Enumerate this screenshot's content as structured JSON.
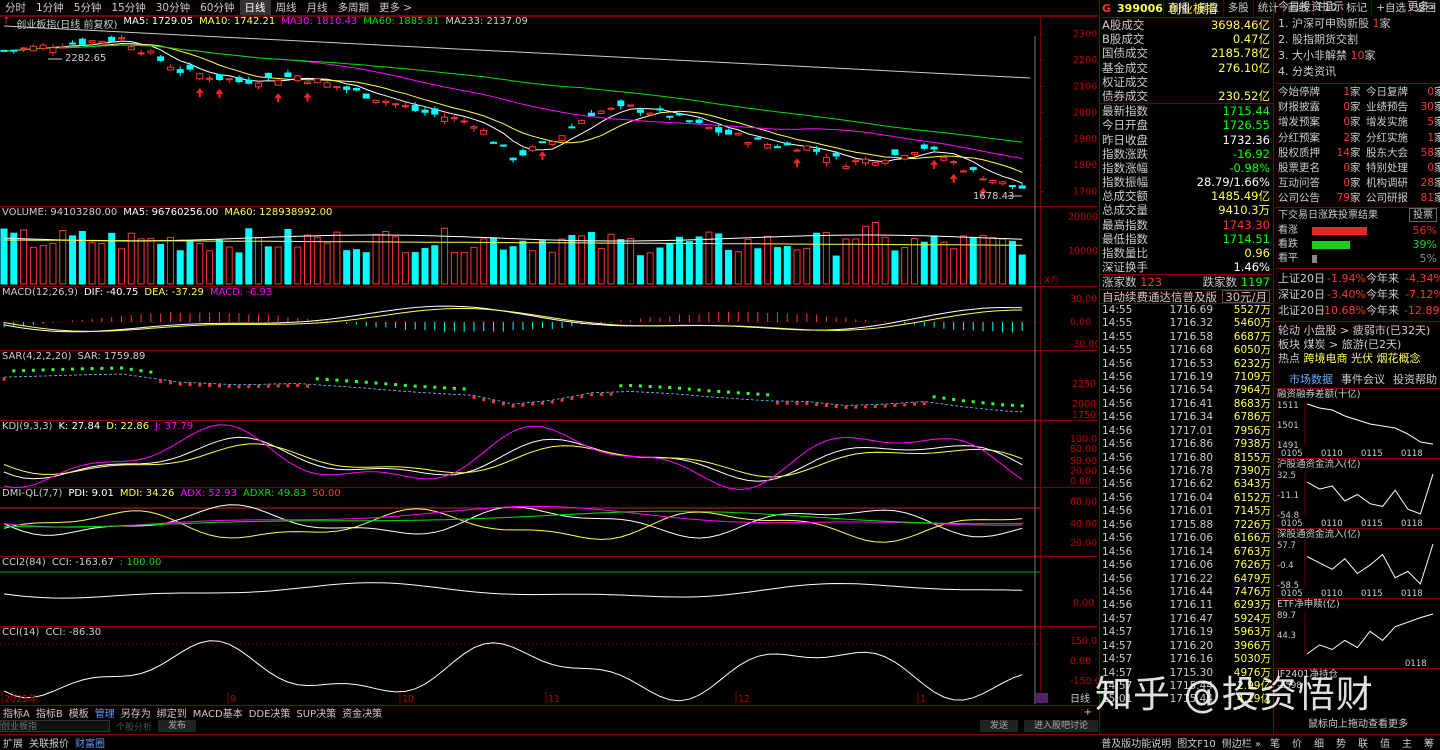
{
  "toolbar": {
    "periods": [
      "分时",
      "1分钟",
      "5分钟",
      "15分钟",
      "30分钟",
      "60分钟",
      "日线",
      "周线",
      "月线",
      "多周期",
      "更多 >"
    ],
    "active": "日线",
    "tools": [
      "直播",
      "复盘",
      "多股",
      "统计",
      "画线",
      "F10",
      "标记",
      "+自选",
      "返回"
    ]
  },
  "indicators": {
    "main": {
      "name": "创业板指(日线 前复权)",
      "ma5": "MA5: 1729.05",
      "ma10": "MA10: 1742.21",
      "ma30": "MA30: 1810.43",
      "ma60": "MA60: 1885.81",
      "ma233": "MA233: 2137.09",
      "high_label": "2282.65",
      "low_label": "1678.43",
      "yaxis": [
        "2300",
        "2200",
        "2100",
        "2000",
        "1900",
        "1800",
        "1700"
      ]
    },
    "volume": {
      "name": "VOLUME: 94103280.00",
      "ma5": "MA5: 96760256.00",
      "ma60": "MA60: 128938992.00",
      "yaxis": [
        "20000",
        "10000"
      ],
      "unit": "X万"
    },
    "macd": {
      "name": "MACD(12,26,9)",
      "dif": "DIF: -40.75",
      "dea": "DEA: -37.29",
      "macd": "MACD: -6.93",
      "yaxis": [
        "30.00",
        "0.00",
        "-30.00"
      ]
    },
    "sar": {
      "name": "SAR(4,2,2,20)",
      "sar": "SAR: 1759.89",
      "yaxis": [
        "2250",
        "2000",
        "1750"
      ]
    },
    "kdj": {
      "name": "KDJ(9,3,3)",
      "k": "K: 27.84",
      "d": "D: 22.86",
      "j": "J: 37.79",
      "yaxis": [
        "100.00",
        "80.00",
        "50.00",
        "20.00",
        "0.00"
      ]
    },
    "dmi": {
      "name": "DMI-QL(7,7)",
      "pdi": "PDI: 9.01",
      "mdi": "MDI: 34.26",
      "adx": "ADX: 52.93",
      "adxr": "ADXR: 49.83",
      "ref": "50.00",
      "yaxis": [
        "60.00",
        "40.00",
        "20.00"
      ]
    },
    "cci2": {
      "name": "CCI2(84)",
      "cci": "CCI: -163.67",
      "ref": ": 100.00",
      "yaxis": [
        "0.00"
      ]
    },
    "cci": {
      "name": "CCI(14)",
      "cci": "CCI: -86.30",
      "yaxis": [
        "150.00",
        "0.00",
        "-150.00"
      ]
    },
    "dates": [
      "2023年",
      "9",
      "10",
      "11",
      "12",
      "1"
    ]
  },
  "bottom_tabs": [
    "指标A",
    "指标B",
    "模板",
    "管理",
    "另存为",
    "绑定到",
    "MACD基本",
    "DDE决策",
    "SUP决策",
    "资金决策"
  ],
  "bottom_active": "管理",
  "search": {
    "placeholder": "创业板指",
    "hint": "个股分析",
    "button": "发布",
    "btn2": "发送",
    "btn3": "进入股吧讨论"
  },
  "status": {
    "items": [
      "扩展",
      "关联报价",
      "财富圈"
    ],
    "active": "财富圈",
    "right": [
      "普及版功能说明",
      "图文F10",
      "侧边栏 »"
    ],
    "keys": [
      "笔",
      "价",
      "细",
      "势",
      "联",
      "值",
      "主",
      "筹"
    ]
  },
  "quote": {
    "code": "399006",
    "name": "创业板指",
    "stats": [
      {
        "k": "A股成交",
        "v": "3698.46亿",
        "c": "#ff5"
      },
      {
        "k": "B股成交",
        "v": "0.47亿",
        "c": "#ff5"
      },
      {
        "k": "国债成交",
        "v": "2185.78亿",
        "c": "#ff5"
      },
      {
        "k": "基金成交",
        "v": "276.10亿",
        "c": "#ff5"
      },
      {
        "k": "权证成交",
        "v": "",
        "c": "#ff5"
      },
      {
        "k": "债券成交",
        "v": "230.52亿",
        "c": "#ff5"
      }
    ],
    "prices": [
      {
        "k": "最新指数",
        "v": "1715.44",
        "c": "#0f0"
      },
      {
        "k": "今日开盘",
        "v": "1726.55",
        "c": "#0f0"
      },
      {
        "k": "昨日收盘",
        "v": "1732.36",
        "c": "#fff"
      },
      {
        "k": "指数涨跌",
        "v": "-16.92",
        "c": "#0f0"
      },
      {
        "k": "指数涨幅",
        "v": "-0.98%",
        "c": "#0f0"
      },
      {
        "k": "指数振幅",
        "v": "28.79/1.66%",
        "c": "#fff"
      },
      {
        "k": "总成交额",
        "v": "1485.49亿",
        "c": "#ff5"
      },
      {
        "k": "总成交量",
        "v": "9410.3万",
        "c": "#ff5"
      },
      {
        "k": "最高指数",
        "v": "1743.30",
        "c": "#f33"
      },
      {
        "k": "最低指数",
        "v": "1714.51",
        "c": "#0f0"
      },
      {
        "k": "指数量比",
        "v": "0.96",
        "c": "#ff5"
      },
      {
        "k": "深证换手",
        "v": "1.46%",
        "c": "#fff"
      }
    ],
    "updown": {
      "k1": "涨家数",
      "v1": "123",
      "k2": "跌家数",
      "v2": "1197"
    },
    "ad": "自动续费通达信普及版",
    "price": "30元/月",
    "ticks": [
      [
        "14:55",
        "1716.69",
        "5527万"
      ],
      [
        "14:55",
        "1716.32",
        "5460万"
      ],
      [
        "14:55",
        "1716.58",
        "6687万"
      ],
      [
        "14:55",
        "1716.68",
        "6050万"
      ],
      [
        "14:56",
        "1716.53",
        "6232万"
      ],
      [
        "14:56",
        "1716.19",
        "7109万"
      ],
      [
        "14:56",
        "1716.54",
        "7964万"
      ],
      [
        "14:56",
        "1716.41",
        "8683万"
      ],
      [
        "14:56",
        "1716.34",
        "6786万"
      ],
      [
        "14:56",
        "1717.01",
        "7956万"
      ],
      [
        "14:56",
        "1716.86",
        "7938万"
      ],
      [
        "14:56",
        "1716.80",
        "8155万"
      ],
      [
        "14:56",
        "1716.78",
        "7390万"
      ],
      [
        "14:56",
        "1716.62",
        "6343万"
      ],
      [
        "14:56",
        "1716.04",
        "6152万"
      ],
      [
        "14:56",
        "1716.01",
        "7145万"
      ],
      [
        "14:56",
        "1715.88",
        "7226万"
      ],
      [
        "14:56",
        "1716.06",
        "6166万"
      ],
      [
        "14:56",
        "1716.14",
        "6763万"
      ],
      [
        "14:56",
        "1716.06",
        "7626万"
      ],
      [
        "14:56",
        "1716.22",
        "6479万"
      ],
      [
        "14:56",
        "1716.44",
        "7476万"
      ],
      [
        "14:56",
        "1716.11",
        "6293万"
      ],
      [
        "14:57",
        "1716.47",
        "5924万"
      ],
      [
        "14:57",
        "1716.19",
        "5963万"
      ],
      [
        "14:57",
        "1716.20",
        "3966万"
      ],
      [
        "14:57",
        "1716.16",
        "5030万"
      ],
      [
        "14:57",
        "1715.30",
        "4976万"
      ],
      [
        "14:57",
        "1715.44",
        "2.99亿"
      ],
      [
        "15:01",
        "1715.44",
        "4.19亿"
      ]
    ]
  },
  "right": {
    "title": "今日投资提示",
    "more": "更多»",
    "tips": [
      {
        "n": "1.",
        "t": "沪深可申购新股",
        "c": "1",
        "u": "家"
      },
      {
        "n": "2.",
        "t": "股指期货交割",
        "c": "",
        "u": ""
      },
      {
        "n": "3.",
        "t": "大小非解禁",
        "c": "10",
        "u": "家"
      },
      {
        "n": "4.",
        "t": "分类资讯",
        "c": "",
        "u": ""
      }
    ],
    "events": [
      [
        "今始停牌",
        "1",
        "家",
        "今日复牌",
        "0",
        "家"
      ],
      [
        "财报披露",
        "0",
        "家",
        "业绩预告",
        "30",
        "家"
      ],
      [
        "增发预案",
        "0",
        "家",
        "增发实施",
        "5",
        "家"
      ],
      [
        "分红预案",
        "2",
        "家",
        "分红实施",
        "1",
        "家"
      ],
      [
        "股权质押",
        "14",
        "家",
        "股东大会",
        "58",
        "家"
      ],
      [
        "股票更名",
        "0",
        "家",
        "特别处理",
        "0",
        "家"
      ],
      [
        "互动问答",
        "0",
        "家",
        "机构调研",
        "28",
        "家"
      ],
      [
        "公司公告",
        "79",
        "家",
        "公司研报",
        "81",
        "家"
      ]
    ],
    "vote_title": "下交易日涨跌投票结果",
    "vote_btn": "投票",
    "votes": [
      {
        "k": "看涨",
        "v": "56%",
        "f": 0.56,
        "c": "#e22"
      },
      {
        "k": "看跌",
        "v": "39%",
        "f": 0.39,
        "c": "#2c2"
      },
      {
        "k": "看平",
        "v": "5%",
        "f": 0.05,
        "c": "#888"
      }
    ],
    "perf": [
      [
        "上证20日",
        "-1.94%",
        "今年来",
        "-4.34%"
      ],
      [
        "深证20日",
        "-3.40%",
        "今年来",
        "-7.12%"
      ],
      [
        "北证20日",
        "-10.68%",
        "今年来",
        "-12.89%"
      ]
    ],
    "rotate": "轮动 小盘股 > 疲弱市(已32天)",
    "sector": "板块 煤炭 > 旅游(已2天)",
    "hot_label": "热点",
    "hot": "跨境电商 光伏 烟花概念",
    "tabs": [
      "市场数据",
      "事件会议",
      "投资帮助"
    ],
    "minis": [
      {
        "title": "融资融券差额(十亿)",
        "y": [
          "1511",
          "1501",
          "1491"
        ],
        "x": [
          "0105",
          "0110",
          "0115",
          "0118"
        ],
        "vals": [
          1511,
          1509,
          1508,
          1505,
          1503,
          1501,
          1500,
          1499,
          1496,
          1492,
          1491
        ]
      },
      {
        "title": "沪股通资金流入(亿)",
        "y": [
          "32.5",
          "-11.1",
          "-54.8"
        ],
        "x": [
          "0105",
          "0110",
          "0115",
          "0118"
        ],
        "vals": [
          5,
          -8,
          -2,
          -30,
          -18,
          -35,
          -40,
          -10,
          -45,
          -54,
          20
        ]
      },
      {
        "title": "深股通资金流入(亿)",
        "y": [
          "57.7",
          "-0.4",
          "-58.5"
        ],
        "x": [
          "0105",
          "0110",
          "0115",
          "0118"
        ],
        "vals": [
          10,
          -5,
          -20,
          5,
          -30,
          -10,
          15,
          -40,
          -25,
          -55,
          40
        ]
      },
      {
        "title": "ETF净申赎(亿)",
        "y": [
          "89.7",
          "44.3"
        ],
        "x": [
          "0118"
        ],
        "vals": [
          45,
          55,
          50,
          60,
          52,
          70,
          60,
          75,
          80,
          85,
          89
        ]
      },
      {
        "title": "IF2401净持仓",
        "y": [
          "-2598"
        ],
        "x": [],
        "vals": []
      }
    ],
    "foot": "鼠标向上拖动查看更多"
  },
  "watermark": "知乎 @投资悟财"
}
